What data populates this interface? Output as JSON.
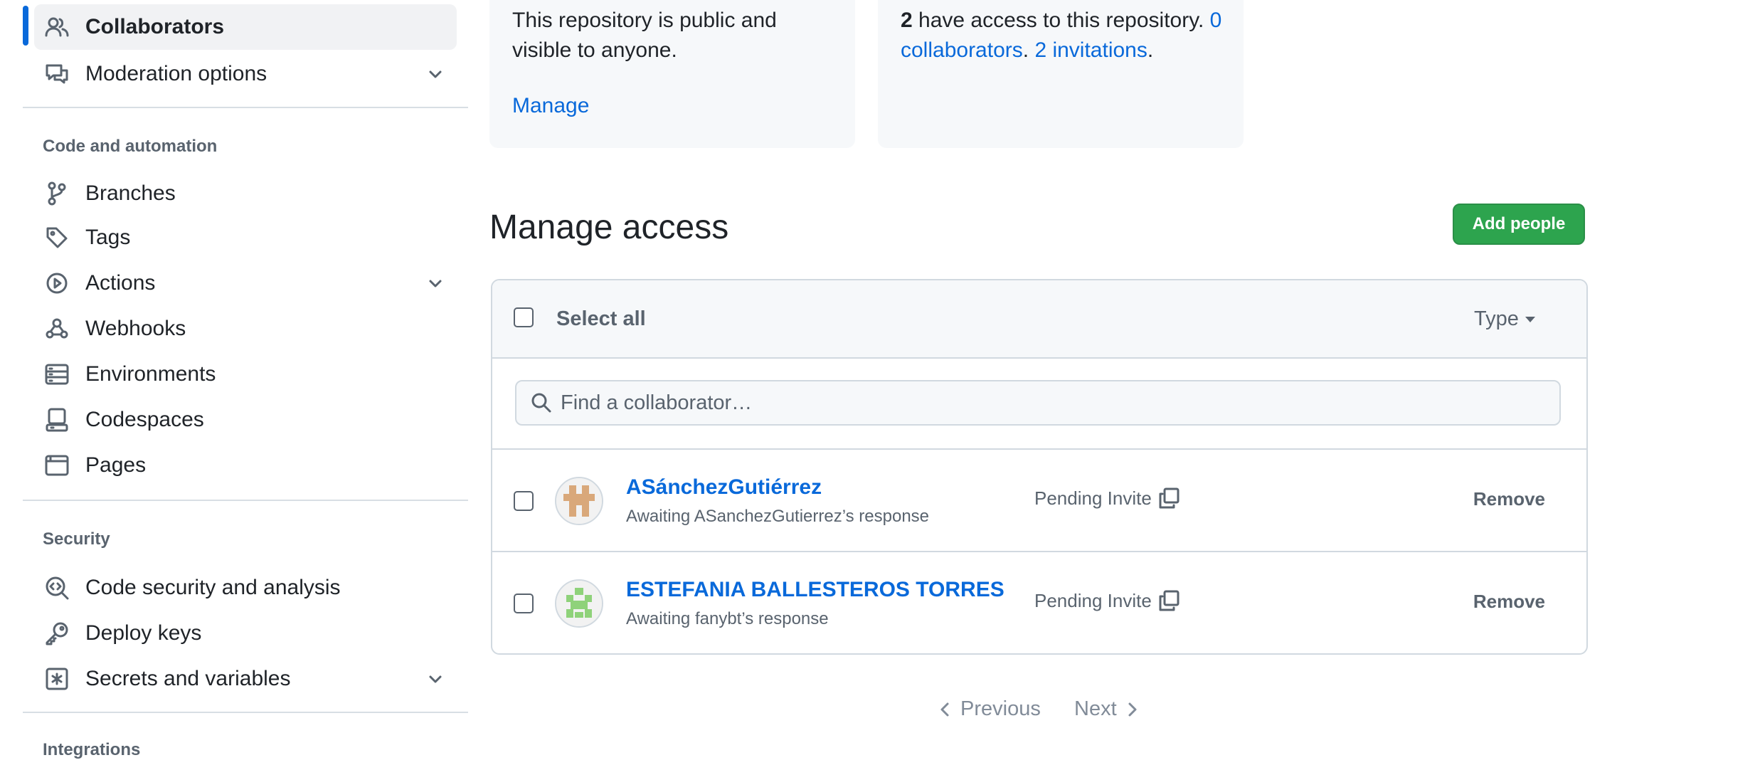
{
  "sidebar": {
    "items_top": [
      {
        "label": "Collaborators",
        "icon": "people-icon",
        "active": true
      },
      {
        "label": "Moderation options",
        "icon": "comment-discussion-icon",
        "expandable": true
      }
    ],
    "sections": [
      {
        "title": "Code and automation",
        "items": [
          {
            "label": "Branches",
            "icon": "git-branch-icon"
          },
          {
            "label": "Tags",
            "icon": "tag-icon"
          },
          {
            "label": "Actions",
            "icon": "play-icon",
            "expandable": true
          },
          {
            "label": "Webhooks",
            "icon": "webhook-icon"
          },
          {
            "label": "Environments",
            "icon": "server-icon"
          },
          {
            "label": "Codespaces",
            "icon": "codespaces-icon"
          },
          {
            "label": "Pages",
            "icon": "browser-icon"
          }
        ]
      },
      {
        "title": "Security",
        "items": [
          {
            "label": "Code security and analysis",
            "icon": "codescan-icon"
          },
          {
            "label": "Deploy keys",
            "icon": "key-icon"
          },
          {
            "label": "Secrets and variables",
            "icon": "asterisk-icon",
            "expandable": true
          }
        ]
      },
      {
        "title": "Integrations",
        "items": []
      }
    ]
  },
  "cards": {
    "public": {
      "text": "This repository is public and visible to anyone.",
      "link": "Manage"
    },
    "access": {
      "count": "2",
      "text_after_count": " have access to this repository. ",
      "collaborators_link": "0 collaborators",
      "separator": ". ",
      "invitations_link": "2 invitations",
      "end": "."
    }
  },
  "manage_access": {
    "title": "Manage access",
    "add_button": "Add people",
    "select_all": "Select all",
    "type_filter": "Type",
    "search_placeholder": "Find a collaborator…",
    "rows": [
      {
        "name": "ASánchezGutiérrez",
        "sub": "Awaiting ASanchezGutierrez’s response",
        "status": "Pending Invite",
        "action": "Remove"
      },
      {
        "name": "ESTEFANIA BALLESTEROS TORRES",
        "sub": "Awaiting fanybt’s response",
        "status": "Pending Invite",
        "action": "Remove"
      }
    ]
  },
  "pagination": {
    "previous": "Previous",
    "next": "Next"
  },
  "colors": {
    "accent": "#0969da",
    "primary_button": "#2da44e",
    "muted": "#59636e"
  }
}
